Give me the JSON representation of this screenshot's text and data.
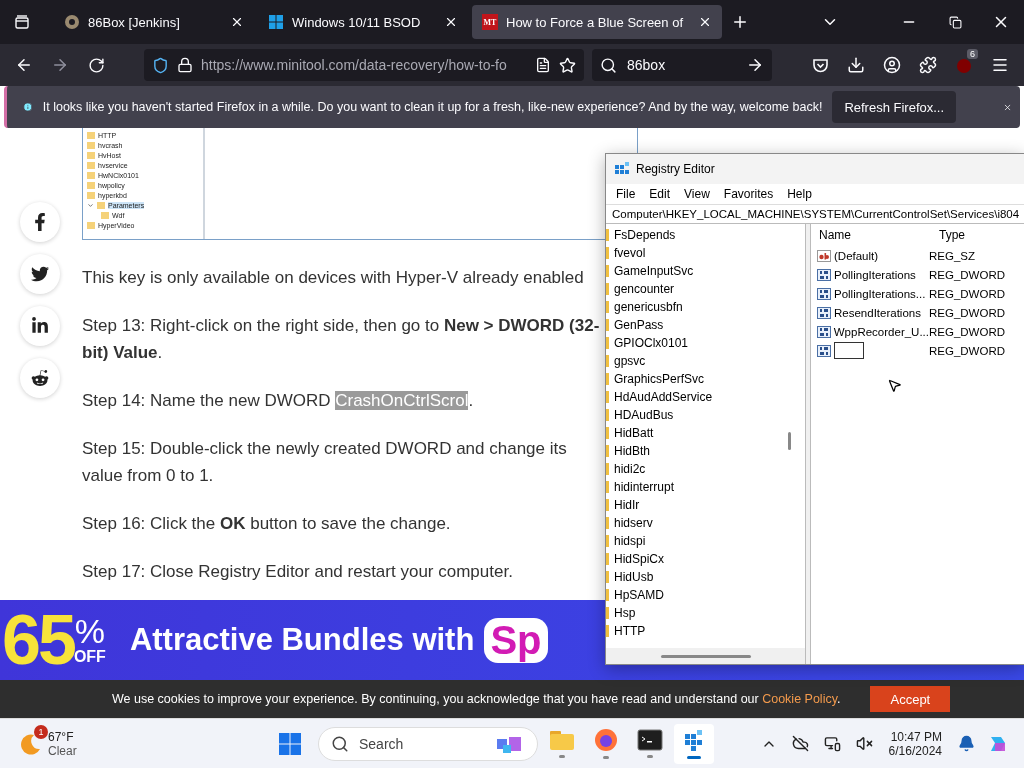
{
  "browser": {
    "tabs": [
      {
        "title": "86Box [Jenkins]",
        "kind": "gear",
        "selected": false
      },
      {
        "title": "Windows 10/11 BSOD",
        "kind": "windows",
        "selected": false
      },
      {
        "title": "How to Force a Blue Screen of",
        "kind": "letters",
        "favicon_text": "MT",
        "selected": true
      }
    ],
    "url": "https://www.minitool.com/data-recovery/how-to-fo",
    "search": "86box",
    "extension_badge": "6"
  },
  "notification": {
    "message": "It looks like you haven't started Firefox in a while. Do you want to clean it up for a fresh, like-new experience? And by the way, welcome back!",
    "button": "Refresh Firefox..."
  },
  "article": {
    "thumbnail_tree": [
      {
        "label": "HTTP",
        "selected": false
      },
      {
        "label": "hvcrash",
        "selected": false
      },
      {
        "label": "HvHost",
        "selected": false
      },
      {
        "label": "hvservice",
        "selected": false
      },
      {
        "label": "HwNClx0101",
        "selected": false
      },
      {
        "label": "hwpolicy",
        "selected": false
      },
      {
        "label": "hyperkbd",
        "selected": false
      },
      {
        "label": "Parameters",
        "selected": true,
        "expanded": true,
        "children": [
          {
            "label": "Wdf",
            "selected": false
          }
        ]
      },
      {
        "label": "HyperVideo",
        "selected": false
      }
    ],
    "share": [
      {
        "kind": "facebook"
      },
      {
        "kind": "twitter"
      },
      {
        "kind": "linkedin"
      },
      {
        "kind": "reddit"
      }
    ],
    "paragraphs": [
      [
        {
          "text": "This key is only available on devices with Hyper-V already enabled"
        }
      ],
      [
        {
          "text": "Step 13: Right-click on the right side, then go to **New > DWORD (32-bit) Value**."
        }
      ],
      [
        {
          "text": "Step 14: Name the new DWORD "
        },
        {
          "text": "CrashOnCtrlScrol",
          "highlighted": true
        },
        {
          "text": "."
        }
      ],
      [
        {
          "text": "Step 15: Double-click the newly created DWORD and change its value from 0 to 1."
        }
      ],
      [
        {
          "text": "Step 16: Click the **OK** button to save the change."
        }
      ],
      [
        {
          "text": "Step 17: Close Registry Editor and restart your computer."
        }
      ]
    ]
  },
  "ad": {
    "percent": "65",
    "percent_sign": "%",
    "off": "OFF",
    "headline": "Attractive Bundles with",
    "logo": "Sp"
  },
  "cookie": {
    "message": "We use cookies to improve your experience. By continuing, you acknowledge that you have read and understand our",
    "link": "Cookie Policy",
    "after": ".",
    "button": "Accept"
  },
  "regedit": {
    "title": "Registry Editor",
    "menu": [
      "File",
      "Edit",
      "View",
      "Favorites",
      "Help"
    ],
    "address": "Computer\\HKEY_LOCAL_MACHINE\\SYSTEM\\CurrentControlSet\\Services\\i804",
    "keys": [
      "FsDepends",
      "fvevol",
      "GameInputSvc",
      "gencounter",
      "genericusbfn",
      "GenPass",
      "GPIOClx0101",
      "gpsvc",
      "GraphicsPerfSvc",
      "HdAudAddService",
      "HDAudBus",
      "HidBatt",
      "HidBth",
      "hidi2c",
      "hidinterrupt",
      "HidIr",
      "hidserv",
      "hidspi",
      "HidSpiCx",
      "HidUsb",
      "HpSAMD",
      "Hsp",
      "HTTP"
    ],
    "columns": [
      "Name",
      "Type"
    ],
    "values": [
      {
        "kind": "string",
        "name": "(Default)",
        "type": "REG_SZ",
        "editing": false
      },
      {
        "kind": "dword",
        "name": "PollingIterations",
        "type": "REG_DWORD",
        "editing": false
      },
      {
        "kind": "dword",
        "name": "PollingIterations...",
        "type": "REG_DWORD",
        "editing": false
      },
      {
        "kind": "dword",
        "name": "ResendIterations",
        "type": "REG_DWORD",
        "editing": false
      },
      {
        "kind": "dword",
        "name": "WppRecorder_U...",
        "type": "REG_DWORD",
        "editing": false
      },
      {
        "kind": "dword",
        "type": "REG_DWORD",
        "editing": true
      }
    ]
  },
  "taskbar": {
    "weather": {
      "temp": "67°F",
      "condition": "Clear",
      "badge": "1"
    },
    "search": "Search",
    "time": "10:47 PM",
    "date": "6/16/2024",
    "apps": [
      {
        "kind": "folder",
        "selected": false
      },
      {
        "kind": "firefox",
        "selected": false
      },
      {
        "kind": "terminal",
        "selected": false
      },
      {
        "kind": "regedit",
        "selected": true
      }
    ]
  }
}
